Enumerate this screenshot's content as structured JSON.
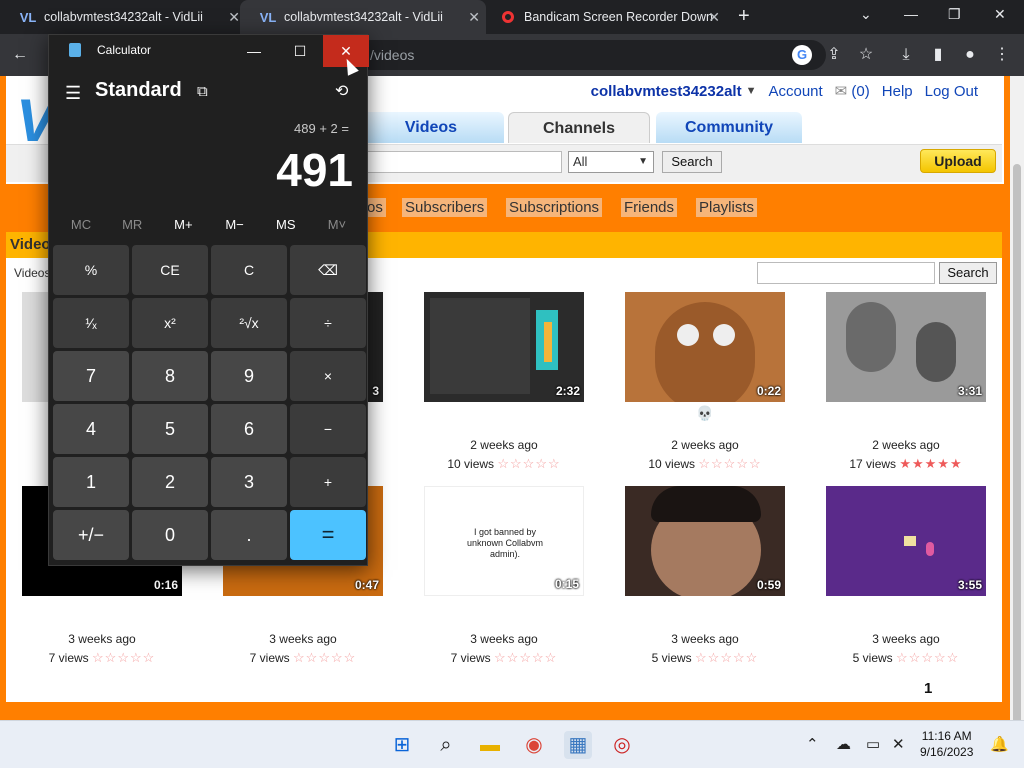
{
  "browser": {
    "tabs": [
      {
        "title": "collabvmtest34232alt - VidLii",
        "active": false
      },
      {
        "title": "collabvmtest34232alt - VidLii",
        "active": true
      },
      {
        "title": "Bandicam Screen Recorder Down",
        "active": false
      }
    ],
    "address": "/videos",
    "favicon_text": "VL"
  },
  "site": {
    "username": "collabvmtest34232alt",
    "account_label": "Account",
    "inbox_count": "(0)",
    "help_label": "Help",
    "logout_label": "Log Out",
    "nav_tabs": [
      "Videos",
      "Channels",
      "Community"
    ],
    "search_select": "All",
    "search_button": "Search",
    "upload_button": "Upload",
    "channel_links": [
      "os",
      "Subscribers",
      "Subscriptions",
      "Friends",
      "Playlists"
    ],
    "section_title": "Video",
    "videos_label": "Videos",
    "content_search_button": "Search",
    "page_number": "1"
  },
  "videos": [
    {
      "dur": "",
      "title": "",
      "date": "",
      "views": "",
      "rating": 0
    },
    {
      "dur": "3",
      "title": "",
      "date": "",
      "views": "",
      "rating": 0
    },
    {
      "dur": "2:32",
      "title": "",
      "date": "2 weeks ago",
      "views": "10 views",
      "rating": 0
    },
    {
      "dur": "0:22",
      "title": "💀",
      "date": "2 weeks ago",
      "views": "10 views",
      "rating": 0
    },
    {
      "dur": "3:31",
      "title": "",
      "date": "2 weeks ago",
      "views": "17 views",
      "rating": 5
    },
    {
      "dur": "0:16",
      "title": "",
      "date": "3 weeks ago",
      "views": "7 views",
      "rating": 0
    },
    {
      "dur": "0:47",
      "title": "",
      "date": "3 weeks ago",
      "views": "7 views",
      "rating": 0
    },
    {
      "dur": "0:15",
      "title": "",
      "date": "3 weeks ago",
      "views": "7 views",
      "rating": 0,
      "thumb_text": "I got banned by unknown Collabvm admin)."
    },
    {
      "dur": "0:59",
      "title": "",
      "date": "3 weeks ago",
      "views": "5 views",
      "rating": 0
    },
    {
      "dur": "3:55",
      "title": "",
      "date": "3 weeks ago",
      "views": "5 views",
      "rating": 0
    }
  ],
  "calculator": {
    "title": "Calculator",
    "mode": "Standard",
    "expression": "489 + 2 =",
    "display": "491",
    "memory": [
      "MC",
      "MR",
      "M+",
      "M−",
      "MS",
      "M˅"
    ],
    "keys": [
      "%",
      "CE",
      "C",
      "⌫",
      "¹⁄ₓ",
      "x²",
      "²√x",
      "÷",
      "7",
      "8",
      "9",
      "×",
      "4",
      "5",
      "6",
      "−",
      "1",
      "2",
      "3",
      "+",
      "+/−",
      "0",
      ".",
      "="
    ]
  },
  "taskbar": {
    "time": "11:16 AM",
    "date": "9/16/2023"
  }
}
